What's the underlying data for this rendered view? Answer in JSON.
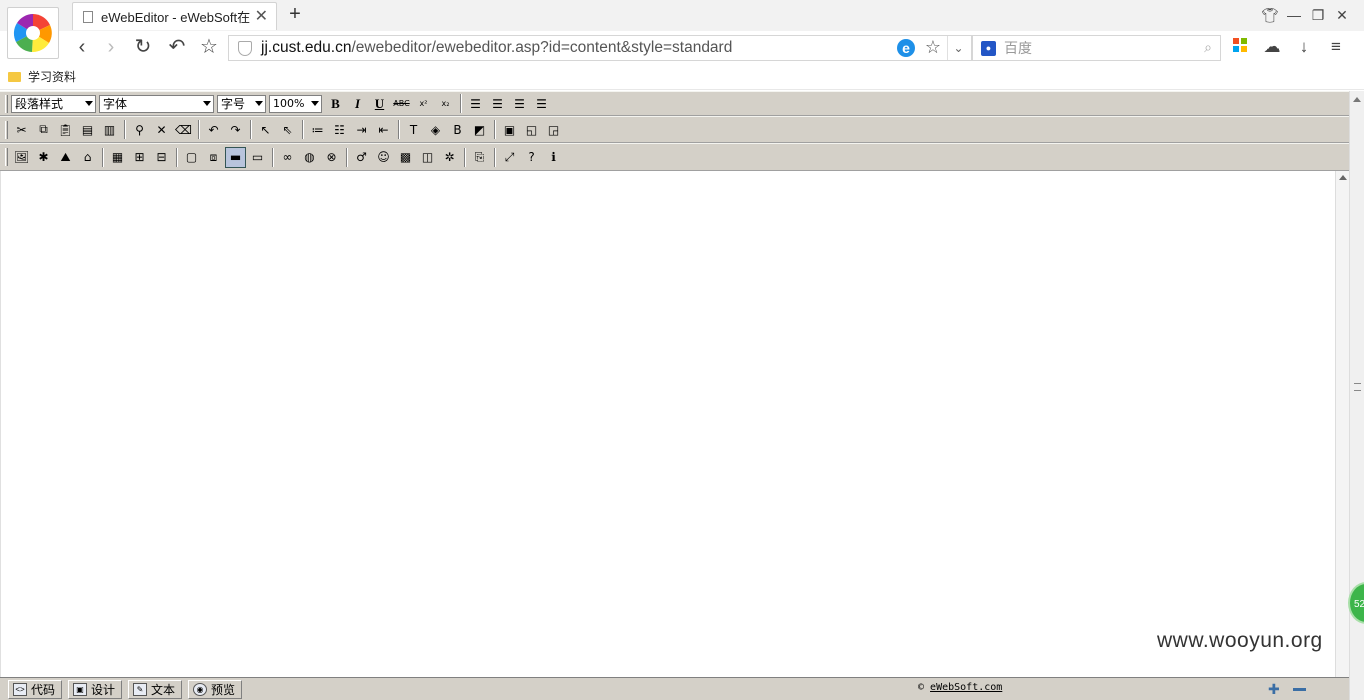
{
  "browser": {
    "tab_title": "eWebEditor - eWebSoft在",
    "new_tab": "+",
    "url_host": "jj.cust.edu.cn",
    "url_path": "/ewebeditor/ewebeditor.asp?id=content&style=standard",
    "search_placeholder": "百度",
    "bookmark": "学习资料"
  },
  "editor": {
    "toolbar": {
      "paragraph_style": "段落样式",
      "font": "字体",
      "font_size": "字号",
      "zoom": "100%",
      "bold": "B",
      "italic": "I",
      "underline": "U",
      "strike": "ABC",
      "superscript": "x²",
      "subscript": "x₂"
    },
    "status": {
      "mode_code": "代码",
      "mode_design": "设计",
      "mode_text": "文本",
      "mode_preview": "预览",
      "brand": "eWebSoft.com"
    }
  },
  "overlay": {
    "watermark": "www.wooyun.org",
    "badge": "52"
  }
}
